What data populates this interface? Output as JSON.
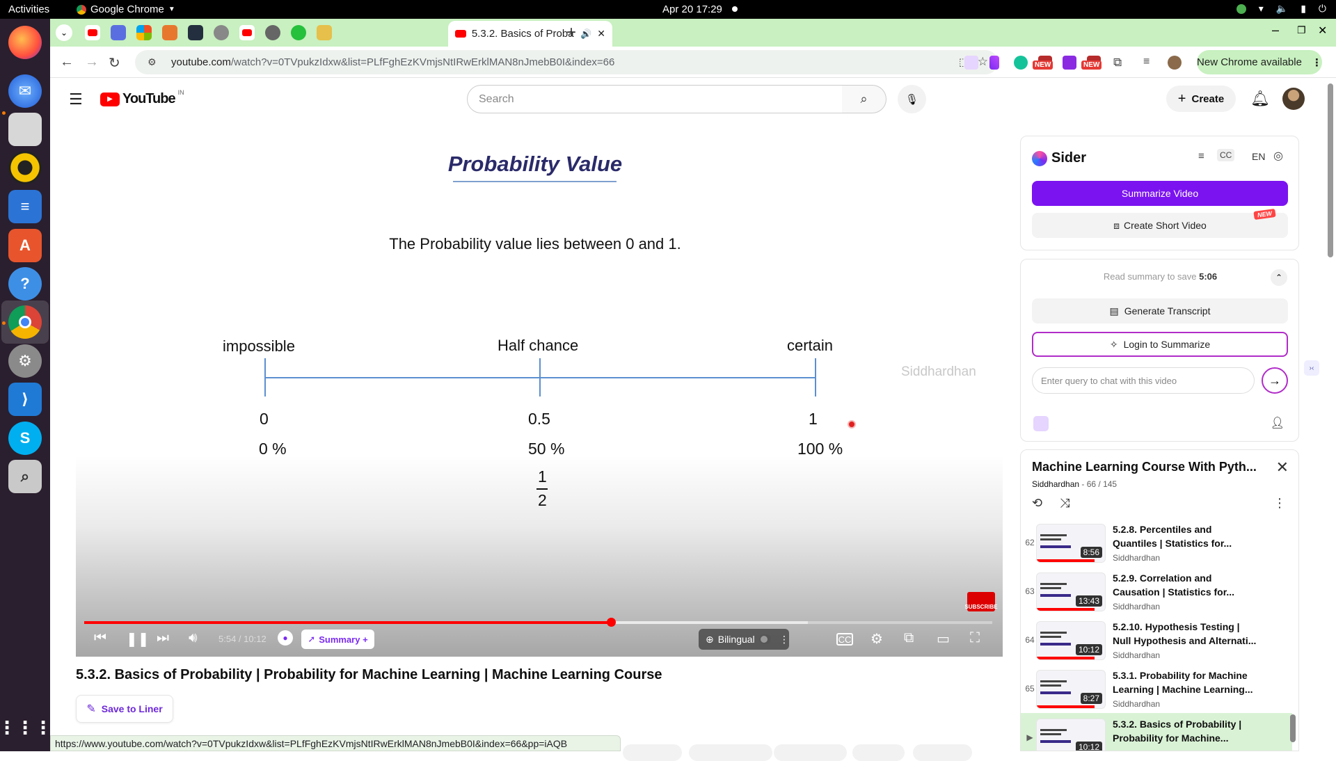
{
  "system": {
    "activities": "Activities",
    "app_name": "Google Chrome",
    "clock": "Apr 20  17:29"
  },
  "browser": {
    "active_tab_title": "5.3.2. Basics of Proba",
    "url_host": "youtube.com",
    "url_path": "/watch?v=0TVpukzIdxw&list=PLfFghEzKVmjsNtIRwErklMAN8nJmebB0I&index=66",
    "new_chrome": "New Chrome available",
    "new_badge": "NEW",
    "status_url": "https://www.youtube.com/watch?v=0TVpukzIdxw&list=PLfFghEzKVmjsNtIRwErklMAN8nJmebB0I&index=66&pp=iAQB"
  },
  "youtube": {
    "logo_text": "YouTube",
    "country": "IN",
    "search_placeholder": "Search",
    "create_label": "Create"
  },
  "slide": {
    "title": "Probability Value",
    "text": "The Probability value lies between 0 and 1.",
    "labels": [
      "impossible",
      "Half chance",
      "certain"
    ],
    "values": [
      "0",
      "0.5",
      "1"
    ],
    "percents": [
      "0 %",
      "50 %",
      "100 %"
    ],
    "frac_num": "1",
    "frac_den": "2",
    "watermark": "Siddhardhan"
  },
  "player": {
    "time": "5:54 / 10:12",
    "played_fraction": 0.58,
    "summary_label": "Summary +",
    "bilingual_label": "Bilingual",
    "subscribe": "SUBSCRIBE"
  },
  "video": {
    "title": "5.3.2. Basics of Probability | Probability for Machine Learning | Machine Learning Course",
    "save_liner": "Save to Liner"
  },
  "sider": {
    "name": "Sider",
    "lang": "EN",
    "summarize_video": "Summarize Video",
    "create_short": "Create Short Video",
    "new_badge": "NEW",
    "read_summary": "Read summary to save",
    "read_summary_time": "5:06",
    "generate_transcript": "Generate Transcript",
    "login_summarize": "Login to Summarize",
    "chat_placeholder": "Enter query to chat with this video"
  },
  "playlist": {
    "title": "Machine Learning Course With Pyth...",
    "channel": "Siddhardhan",
    "position": "66 / 145",
    "items": [
      {
        "index": "62",
        "title": "5.2.8. Percentiles and Quantiles | Statistics for...",
        "channel": "Siddhardhan",
        "duration": "8:56",
        "watched": 0.85
      },
      {
        "index": "63",
        "title": "5.2.9. Correlation and Causation | Statistics for...",
        "channel": "Siddhardhan",
        "duration": "13:43",
        "watched": 0.85
      },
      {
        "index": "64",
        "title": "5.2.10. Hypothesis Testing | Null Hypothesis and Alternati...",
        "channel": "Siddhardhan",
        "duration": "10:12",
        "watched": 0.85
      },
      {
        "index": "65",
        "title": "5.3.1. Probability for Machine Learning | Machine Learning...",
        "channel": "Siddhardhan",
        "duration": "8:27",
        "watched": 0.85
      },
      {
        "index": "▶",
        "title": "5.3.2. Basics of Probability | Probability for Machine...",
        "channel": "",
        "duration": "10:12",
        "watched": 0.6
      }
    ]
  },
  "colors": {
    "youtube_red": "#ff0000",
    "sider_purple": "#7b13f0",
    "tabstrip_green": "#c8f0c0",
    "dock_bg": "#2a1f2e"
  }
}
